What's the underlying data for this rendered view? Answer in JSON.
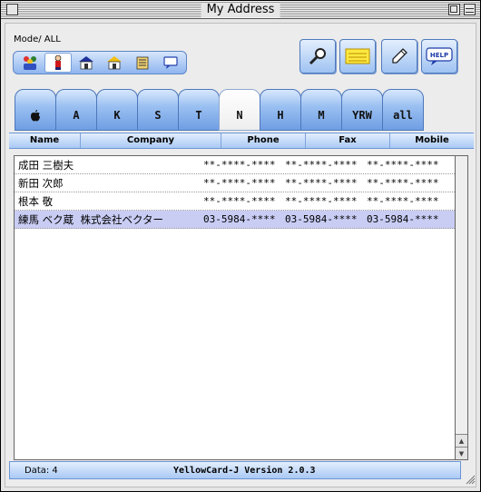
{
  "window": {
    "title": "My Address"
  },
  "mode": {
    "label": "Mode/ ALL",
    "buttons": [
      {
        "icon": "people-icon",
        "active": false
      },
      {
        "icon": "person-icon",
        "active": true
      },
      {
        "icon": "house-blue-icon",
        "active": false
      },
      {
        "icon": "house-yellow-icon",
        "active": false
      },
      {
        "icon": "building-icon",
        "active": false
      },
      {
        "icon": "speech-bubble-icon",
        "active": false
      }
    ]
  },
  "toolbar": {
    "search_icon": "magnifier-icon",
    "note_icon": "notepad-icon",
    "edit_icon": "pencil-icon",
    "help_label": "HELP"
  },
  "tabs": [
    {
      "label": "",
      "icon": "apple-icon",
      "active": false
    },
    {
      "label": "A",
      "active": false
    },
    {
      "label": "K",
      "active": false
    },
    {
      "label": "S",
      "active": false
    },
    {
      "label": "T",
      "active": false
    },
    {
      "label": "N",
      "active": true
    },
    {
      "label": "H",
      "active": false
    },
    {
      "label": "M",
      "active": false
    },
    {
      "label": "YRW",
      "active": false
    },
    {
      "label": "all",
      "active": false
    }
  ],
  "columns": [
    "Name",
    "Company",
    "Phone",
    "Fax",
    "Mobile"
  ],
  "rows": [
    {
      "name": "成田 三樹夫",
      "company": "",
      "phone": "**-****-****",
      "fax": "**-****-****",
      "mobile": "**-****-****",
      "selected": false
    },
    {
      "name": "新田 次郎",
      "company": "",
      "phone": "**-****-****",
      "fax": "**-****-****",
      "mobile": "**-****-****",
      "selected": false
    },
    {
      "name": "根本 敬",
      "company": "",
      "phone": "**-****-****",
      "fax": "**-****-****",
      "mobile": "**-****-****",
      "selected": false
    },
    {
      "name": "練馬 ベク蔵",
      "company": "株式会社ベクター",
      "phone": "03-5984-****",
      "fax": "03-5984-****",
      "mobile": "03-5984-****",
      "selected": true
    }
  ],
  "status": {
    "data_count": "Data: 4",
    "version": "YellowCard-J Version 2.0.3"
  },
  "colors": {
    "accent": "#9cc1f2",
    "selection": "#c9cdf4"
  }
}
